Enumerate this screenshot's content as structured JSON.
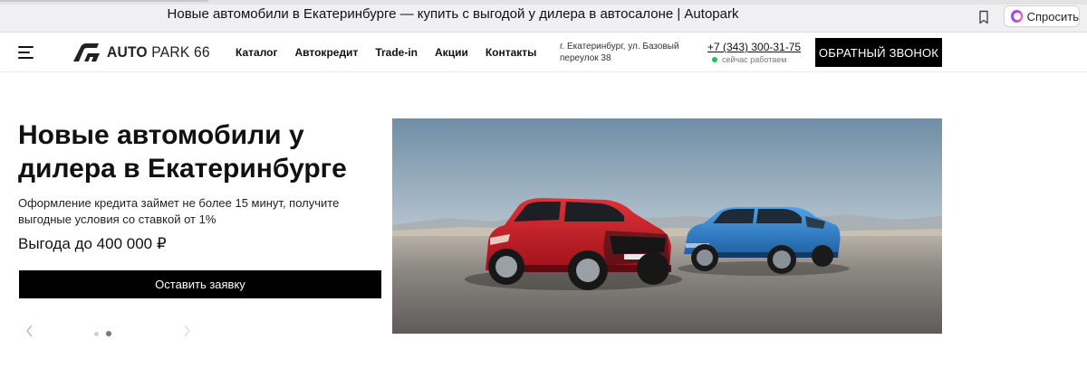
{
  "browser": {
    "tab_title": "Новые автомобили в Екатеринбурге — купить с выгодой у дилера в автосалоне | Autopark",
    "ask_label": "Спросить"
  },
  "header": {
    "logo_text_bold": "AUTO",
    "logo_text_rest": " PARK 66",
    "nav": [
      "Каталог",
      "Автокредит",
      "Trade-in",
      "Акции",
      "Контакты"
    ],
    "address_line1": "г. Екатеринбург, ул. Базовый",
    "address_line2": "переулок 38",
    "phone": "+7 (343) 300-31-75",
    "status": "сейчас работаем",
    "status_color": "#22c15c",
    "callback_label": "ОБРАТНЫЙ ЗВОНОК"
  },
  "hero": {
    "title_line1": "Новые автомобили у",
    "title_line2": "дилера в Екатеринбурге",
    "subtitle_line1": "Оформление кредита займет не более 15 минут, получите",
    "subtitle_line2": "выгодные условия со ставкой от 1%",
    "benefit": "Выгода до 400 000 ₽",
    "cta_label": "Оставить заявку",
    "slides_total": 2,
    "slide_active": 2
  },
  "icons": {
    "menu": "hamburger-icon",
    "bookmark": "bookmark-icon",
    "ask": "ai-sparkle-icon",
    "prev": "chevron-left-icon",
    "next": "chevron-right-icon"
  },
  "colors": {
    "primary": "#000000",
    "red_car": "#c8202a",
    "blue_car": "#2e7fcf"
  }
}
